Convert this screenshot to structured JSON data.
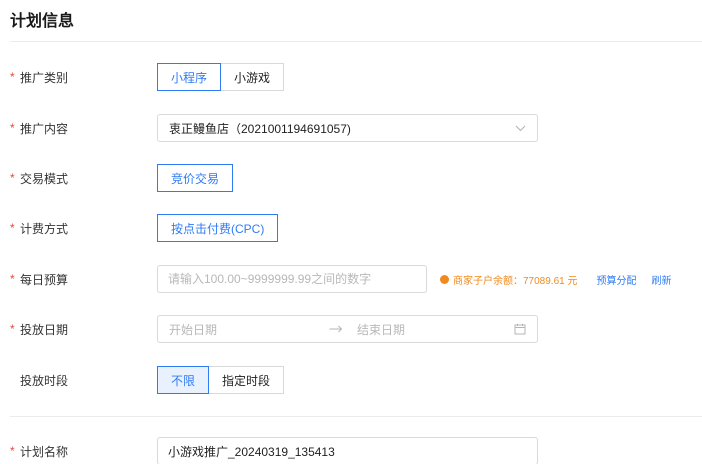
{
  "section": {
    "title": "计划信息"
  },
  "fields": {
    "promo_category": {
      "label": "推广类别",
      "options": [
        "小程序",
        "小游戏"
      ],
      "selected": "小程序"
    },
    "promo_content": {
      "label": "推广内容",
      "value": "衷正鳗鱼店（2021001194691057)"
    },
    "trade_mode": {
      "label": "交易模式",
      "value": "竞价交易"
    },
    "billing": {
      "label": "计费方式",
      "value": "按点击付费(CPC)"
    },
    "daily_budget": {
      "label": "每日预算",
      "placeholder": "请输入100.00~9999999.99之间的数字",
      "balance_text": "商家子户余额：77089.61 元",
      "allocate_link": "预算分配",
      "refresh_link": "刷新"
    },
    "schedule_date": {
      "label": "投放日期",
      "start_placeholder": "开始日期",
      "end_placeholder": "结束日期"
    },
    "schedule_time": {
      "label": "投放时段",
      "options": [
        "不限",
        "指定时段"
      ],
      "selected": "不限"
    },
    "plan_name": {
      "label": "计划名称",
      "value": "小游戏推广_20240319_135413"
    }
  },
  "colors": {
    "accent": "#2f7bf5",
    "required": "#e8473d",
    "warning": "#f08a1e"
  },
  "icons": {
    "select": "chevron-down-icon",
    "date": "calendar-icon",
    "range": "arrow-right-icon",
    "warning": "warning-dot-icon"
  }
}
